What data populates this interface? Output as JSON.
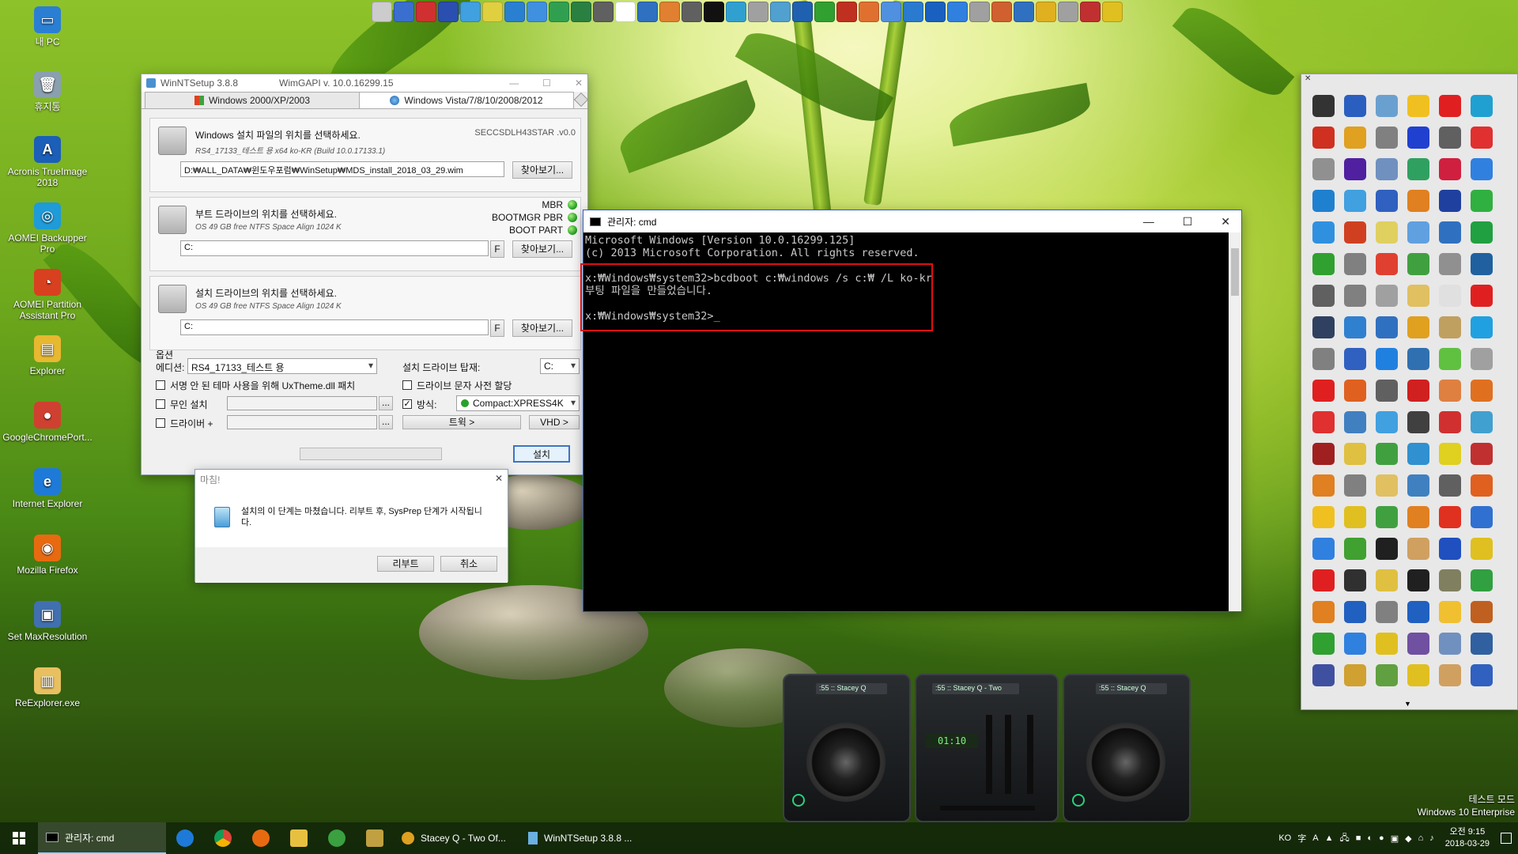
{
  "desktop": {
    "icons": [
      {
        "label": "내 PC",
        "color": "#2a7fd4",
        "glyph": "▭"
      },
      {
        "label": "휴지통",
        "color": "#8aa0b0",
        "glyph": "🗑"
      },
      {
        "label": "Acronis TrueImage 2018",
        "color": "#1b5fb8",
        "glyph": "A"
      },
      {
        "label": "AOMEI Backupper Pro",
        "color": "#1e9bd8",
        "glyph": "◎"
      },
      {
        "label": "AOMEI Partition Assistant Pro",
        "color": "#d84020",
        "glyph": "◔"
      },
      {
        "label": "Explorer",
        "color": "#e8b830",
        "glyph": "▤"
      },
      {
        "label": "GoogleChromePort...",
        "color": "#d04030",
        "glyph": "●"
      },
      {
        "label": "Internet Explorer",
        "color": "#1e7ad8",
        "glyph": "e"
      },
      {
        "label": "Mozilla Firefox",
        "color": "#e86a10",
        "glyph": "◉"
      },
      {
        "label": "Set MaxResolution",
        "color": "#4070b0",
        "glyph": "▣"
      },
      {
        "label": "ReExplorer.exe",
        "color": "#e8c060",
        "glyph": "▥"
      }
    ],
    "watermark_line1": "테스트 모드",
    "watermark_line2": "Windows 10 Enterprise"
  },
  "top_bar_colors": [
    "#ccc",
    "#3a6fd0",
    "#d03030",
    "#2a4fb0",
    "#40a0e0",
    "#e0d040",
    "#2a80d0",
    "#4090e0",
    "#30a050",
    "#2a8040",
    "#606060",
    "#ffffff",
    "#3070c0",
    "#e08030",
    "#606060",
    "#111111",
    "#30a0d0",
    "#a0a0a0",
    "#50a0d0",
    "#2060b0",
    "#30a030",
    "#c03020",
    "#e07030",
    "#5090e0",
    "#2a7ad0",
    "#1a60c0",
    "#3080e0",
    "#a0a0a0",
    "#d06030",
    "#3070c0",
    "#e0b020",
    "#a0a0a0",
    "#c03030",
    "#e0c020"
  ],
  "winntsetup": {
    "title": "WinNTSetup 3.8.8",
    "wimgapi": "WimGAPI v. 10.0.16299.15",
    "tab_xp": "Windows 2000/XP/2003",
    "tab_vista": "Windows Vista/7/8/10/2008/2012",
    "source_heading": "Windows 설치 파일의 위치를 선택하세요.",
    "source_tag": "SECCSDLH43STAR .v0.0",
    "source_sub": "RS4_17133_테스트 용 x64 ko-KR (Build 10.0.17133.1)",
    "source_path": "D:₩ALL_DATA₩윈도우포럼₩WinSetup₩MDS_install_2018_03_29.wim",
    "browse_label": "찾아보기...",
    "boot_heading": "부트 드라이브의 위치를 선택하세요.",
    "boot_sub": "OS 49 GB free NTFS Space Align 1024 K",
    "boot_value": "C:",
    "f_label": "F",
    "mbr": "MBR",
    "bootmgr_pbr": "BOOTMGR PBR",
    "boot_part": "BOOT PART",
    "install_heading": "설치 드라이브의 위치를 선택하세요.",
    "install_sub": "OS 49 GB free NTFS Space Align 1024 K",
    "install_value": "C:",
    "options_label": "옵션",
    "edition_label": "에디션:",
    "edition_value": "RS4_17133_테스트 용",
    "mount_label": "설치 드라이브 탑재:",
    "mount_value": "C:",
    "opt_uxtheme": "서명 안 된 테마 사용을 위해 UxTheme.dll 패치",
    "opt_drive_letter": "드라이브 문자 사전 할당",
    "opt_unattended": "무인 설치",
    "opt_method": "방식:",
    "method_value": "Compact:XPRESS4K",
    "opt_driver": "드라이버 +",
    "ellipsis": "...",
    "tweak_label": "트윅 >",
    "vhd_label": "VHD >",
    "install_button": "설치"
  },
  "done_dialog": {
    "title": "마침!",
    "message": "설치의 이 단계는 마쳤습니다.  리부트 후, SysPrep 단계가 시작됩니다.",
    "reboot_label": "리부트",
    "cancel_label": "취소"
  },
  "cmd": {
    "title": "관리자: cmd",
    "line1": "Microsoft Windows [Version 10.0.16299.125]",
    "line2": "(c) 2013 Microsoft Corporation. All rights reserved.",
    "line3": "x:₩Windows₩system32>bcdboot c:₩windows /s c:₩ /L ko-kr",
    "line4": "부팅 파일을 만들었습니다.",
    "line5": "x:₩Windows₩system32>"
  },
  "dock": {
    "colors": [
      "#333",
      "#2a5fc0",
      "#6aa0d0",
      "#f0c020",
      "#e02020",
      "#20a0d0",
      "#d03020",
      "#e0a020",
      "#808080",
      "#2040d0",
      "#606060",
      "#e03030",
      "#909090",
      "#5020a0",
      "#7090c0",
      "#30a060",
      "#d02040",
      "#3080e0",
      "#2080d0",
      "#40a0e0",
      "#3060c0",
      "#e08020",
      "#2040a0",
      "#30b040",
      "#3090e0",
      "#d04020",
      "#e0d060",
      "#60a0e0",
      "#3070c0",
      "#20a040",
      "#30a030",
      "#808080",
      "#e04030",
      "#40a040",
      "#909090",
      "#2060a0",
      "#606060",
      "#808080",
      "#a0a0a0",
      "#e0c060",
      "#e0e0e0",
      "#e02020",
      "#304060",
      "#3080d0",
      "#3070c0",
      "#e0a020",
      "#c0a060",
      "#20a0e0",
      "#808080",
      "#3060c0",
      "#2080e0",
      "#3070b0",
      "#60c040",
      "#a0a0a0",
      "#e02020",
      "#e06020",
      "#606060",
      "#d02020",
      "#e08040",
      "#e07020",
      "#e03030",
      "#4080c0",
      "#40a0e0",
      "#404040",
      "#d03030",
      "#40a0d0",
      "#a02020",
      "#e0c040",
      "#40a040",
      "#3090d0",
      "#e0d020",
      "#c03030",
      "#e08020",
      "#808080",
      "#e0c060",
      "#4080c0",
      "#606060",
      "#e06020",
      "#f0c020",
      "#e0c020",
      "#40a040",
      "#e08020",
      "#e03020",
      "#3070d0",
      "#3080e0",
      "#40a030",
      "#202020",
      "#d0a060",
      "#2050c0",
      "#e0c020",
      "#e02020",
      "#303030",
      "#e0c040",
      "#202020",
      "#808060",
      "#30a040",
      "#e08020",
      "#2060c0",
      "#808080",
      "#2060c0",
      "#f0c030",
      "#c06020",
      "#30a030",
      "#3080e0",
      "#e0c020",
      "#7050a0",
      "#7090c0",
      "#3060a0",
      "#4050a0",
      "#d0a030",
      "#60a040",
      "#e0c020",
      "#d0a060",
      "#3060c0"
    ]
  },
  "deck": {
    "left_label": ":55 :: Stacey Q",
    "mixer_label": ":55 :: Stacey Q - Two",
    "right_label": ":55 :: Stacey Q",
    "mixer_time": "01:10"
  },
  "taskbar": {
    "cmd_label": "관리자: cmd",
    "stacey_label": "Stacey Q - Two Of...",
    "winnt_label": "WinNTSetup 3.8.8 ...",
    "lang": "KO",
    "time": "오전 9:15",
    "date": "2018-03-29"
  }
}
